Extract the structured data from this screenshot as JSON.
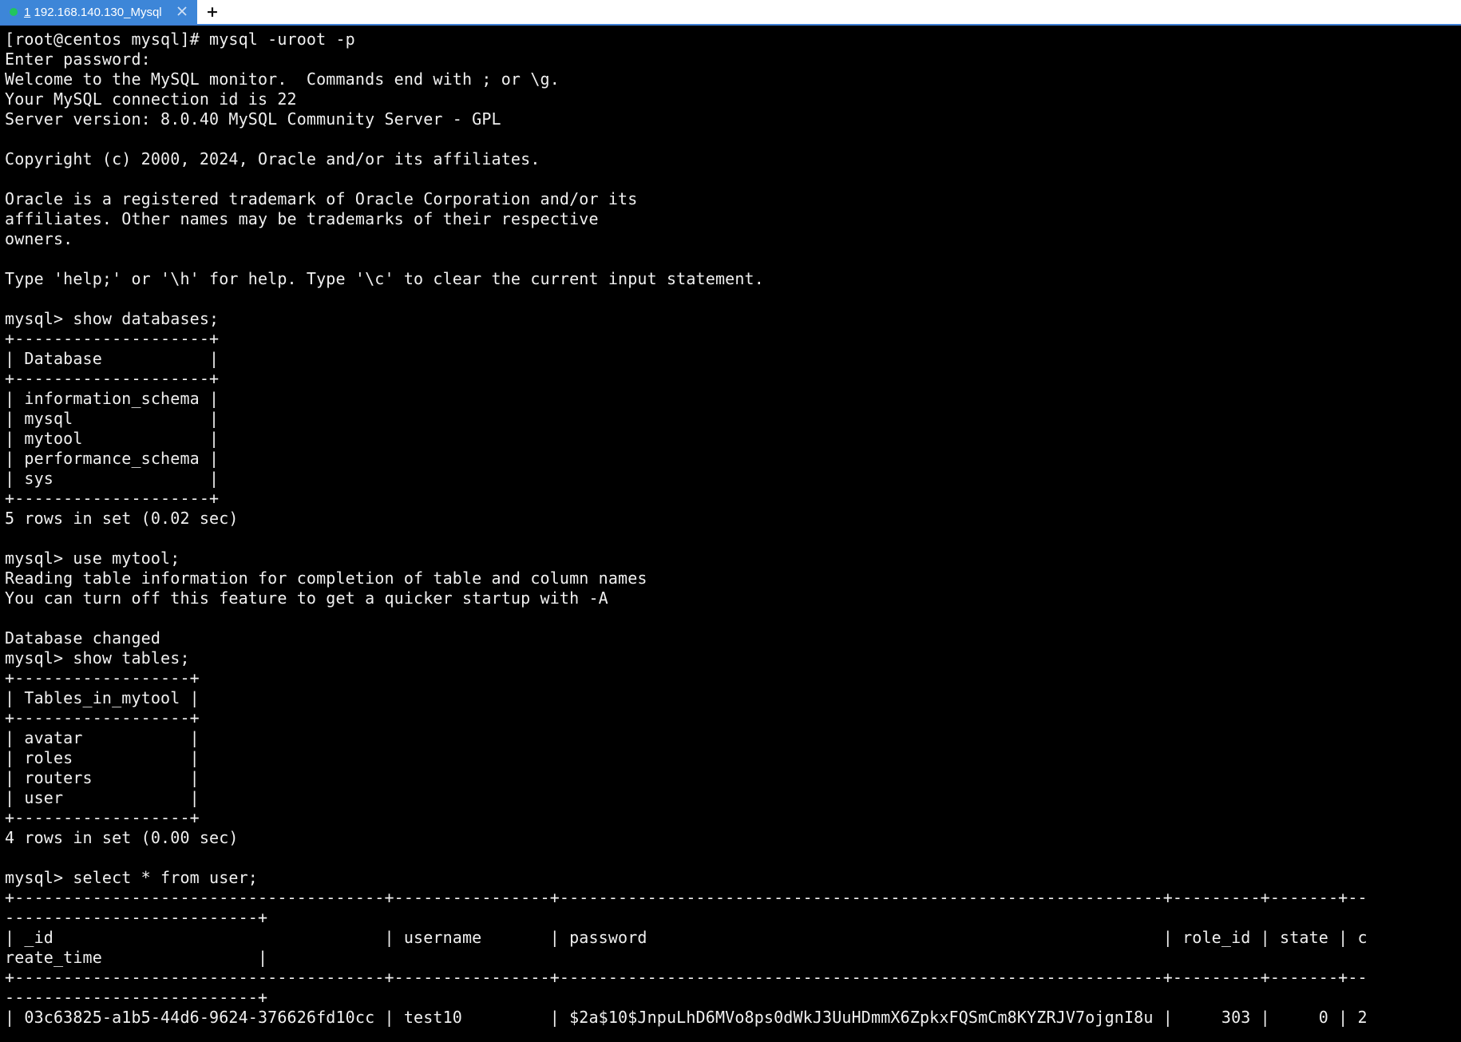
{
  "tab": {
    "number": "1",
    "title": " 192.168.140.130_Mysql",
    "status_color": "#22c55e",
    "icons": {
      "status": "connected-dot-icon",
      "close": "close-icon",
      "add": "plus-icon"
    },
    "new_tab_label": "+"
  },
  "terminal": {
    "lines": [
      "[root@centos mysql]# mysql -uroot -p",
      "Enter password:",
      "Welcome to the MySQL monitor.  Commands end with ; or \\g.",
      "Your MySQL connection id is 22",
      "Server version: 8.0.40 MySQL Community Server - GPL",
      "",
      "Copyright (c) 2000, 2024, Oracle and/or its affiliates.",
      "",
      "Oracle is a registered trademark of Oracle Corporation and/or its",
      "affiliates. Other names may be trademarks of their respective",
      "owners.",
      "",
      "Type 'help;' or '\\h' for help. Type '\\c' to clear the current input statement.",
      "",
      "mysql> show databases;",
      "+--------------------+",
      "| Database           |",
      "+--------------------+",
      "| information_schema |",
      "| mysql              |",
      "| mytool             |",
      "| performance_schema |",
      "| sys                |",
      "+--------------------+",
      "5 rows in set (0.02 sec)",
      "",
      "mysql> use mytool;",
      "Reading table information for completion of table and column names",
      "You can turn off this feature to get a quicker startup with -A",
      "",
      "Database changed",
      "mysql> show tables;",
      "+------------------+",
      "| Tables_in_mytool |",
      "+------------------+",
      "| avatar           |",
      "| roles            |",
      "| routers          |",
      "| user             |",
      "+------------------+",
      "4 rows in set (0.00 sec)",
      "",
      "mysql> select * from user;",
      "+--------------------------------------+----------------+--------------------------------------------------------------+---------+-------+--",
      "--------------------------+",
      "| _id                                  | username       | password                                                     | role_id | state | c",
      "reate_time                |",
      "+--------------------------------------+----------------+--------------------------------------------------------------+---------+-------+--",
      "--------------------------+",
      "| 03c63825-a1b5-44d6-9624-376626fd10cc | test10         | $2a$10$JnpuLhD6MVo8ps0dWkJ3UuHDmmX6ZpkxFQSmCm8KYZRJV7ojgnI8u |     303 |     0 | 2"
    ]
  }
}
